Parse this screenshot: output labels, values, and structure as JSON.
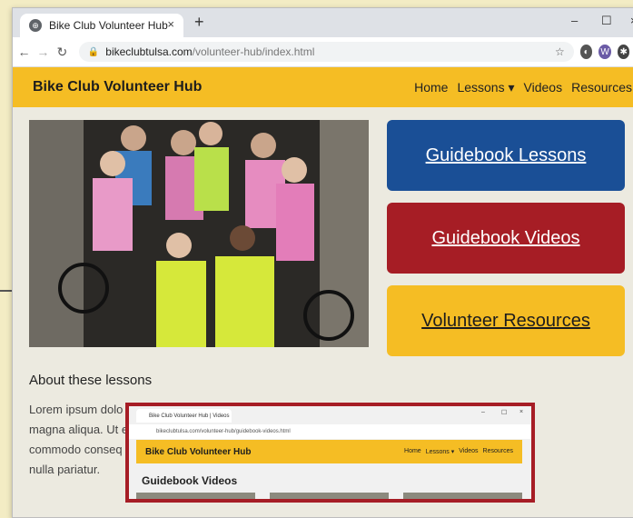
{
  "browser": {
    "tab_title": "Bike Club Volunteer Hub",
    "tab_close": "×",
    "new_tab": "+",
    "url_host": "bikeclubtulsa.com",
    "url_path": "/volunteer-hub/index.html",
    "minimize": "–",
    "maximize": "☐",
    "close": "×"
  },
  "site": {
    "brand": "Bike Club Volunteer Hub",
    "menu": {
      "home": "Home",
      "lessons": "Lessons ▾",
      "videos": "Videos",
      "resources": "Resources"
    }
  },
  "buttons": {
    "lessons": "Guidebook Lessons",
    "videos": "Guidebook Videos",
    "resources": "Volunteer Resources"
  },
  "about": {
    "heading": "About these lessons",
    "lines": [
      "Lorem ipsum dolo                                                                                    labore et dolore",
      "magna aliqua. Ut e                                                                                    uip ex ea",
      "commodo conseq                                                                                  re eu fugiat",
      "nulla pariatur."
    ]
  },
  "inset": {
    "tab_title": "Bike Club Volunteer Hub | Videos",
    "url": "bikeclubtulsa.com/volunteer-hub/guidebook-videos.html",
    "brand": "Bike Club Volunteer Hub",
    "menu": [
      "Home",
      "Lessons ▾",
      "Videos",
      "Resources"
    ],
    "title": "Guidebook Videos"
  },
  "colors": {
    "accent_yellow": "#f5bd24",
    "blue": "#1a4f96",
    "red": "#a61d25"
  }
}
